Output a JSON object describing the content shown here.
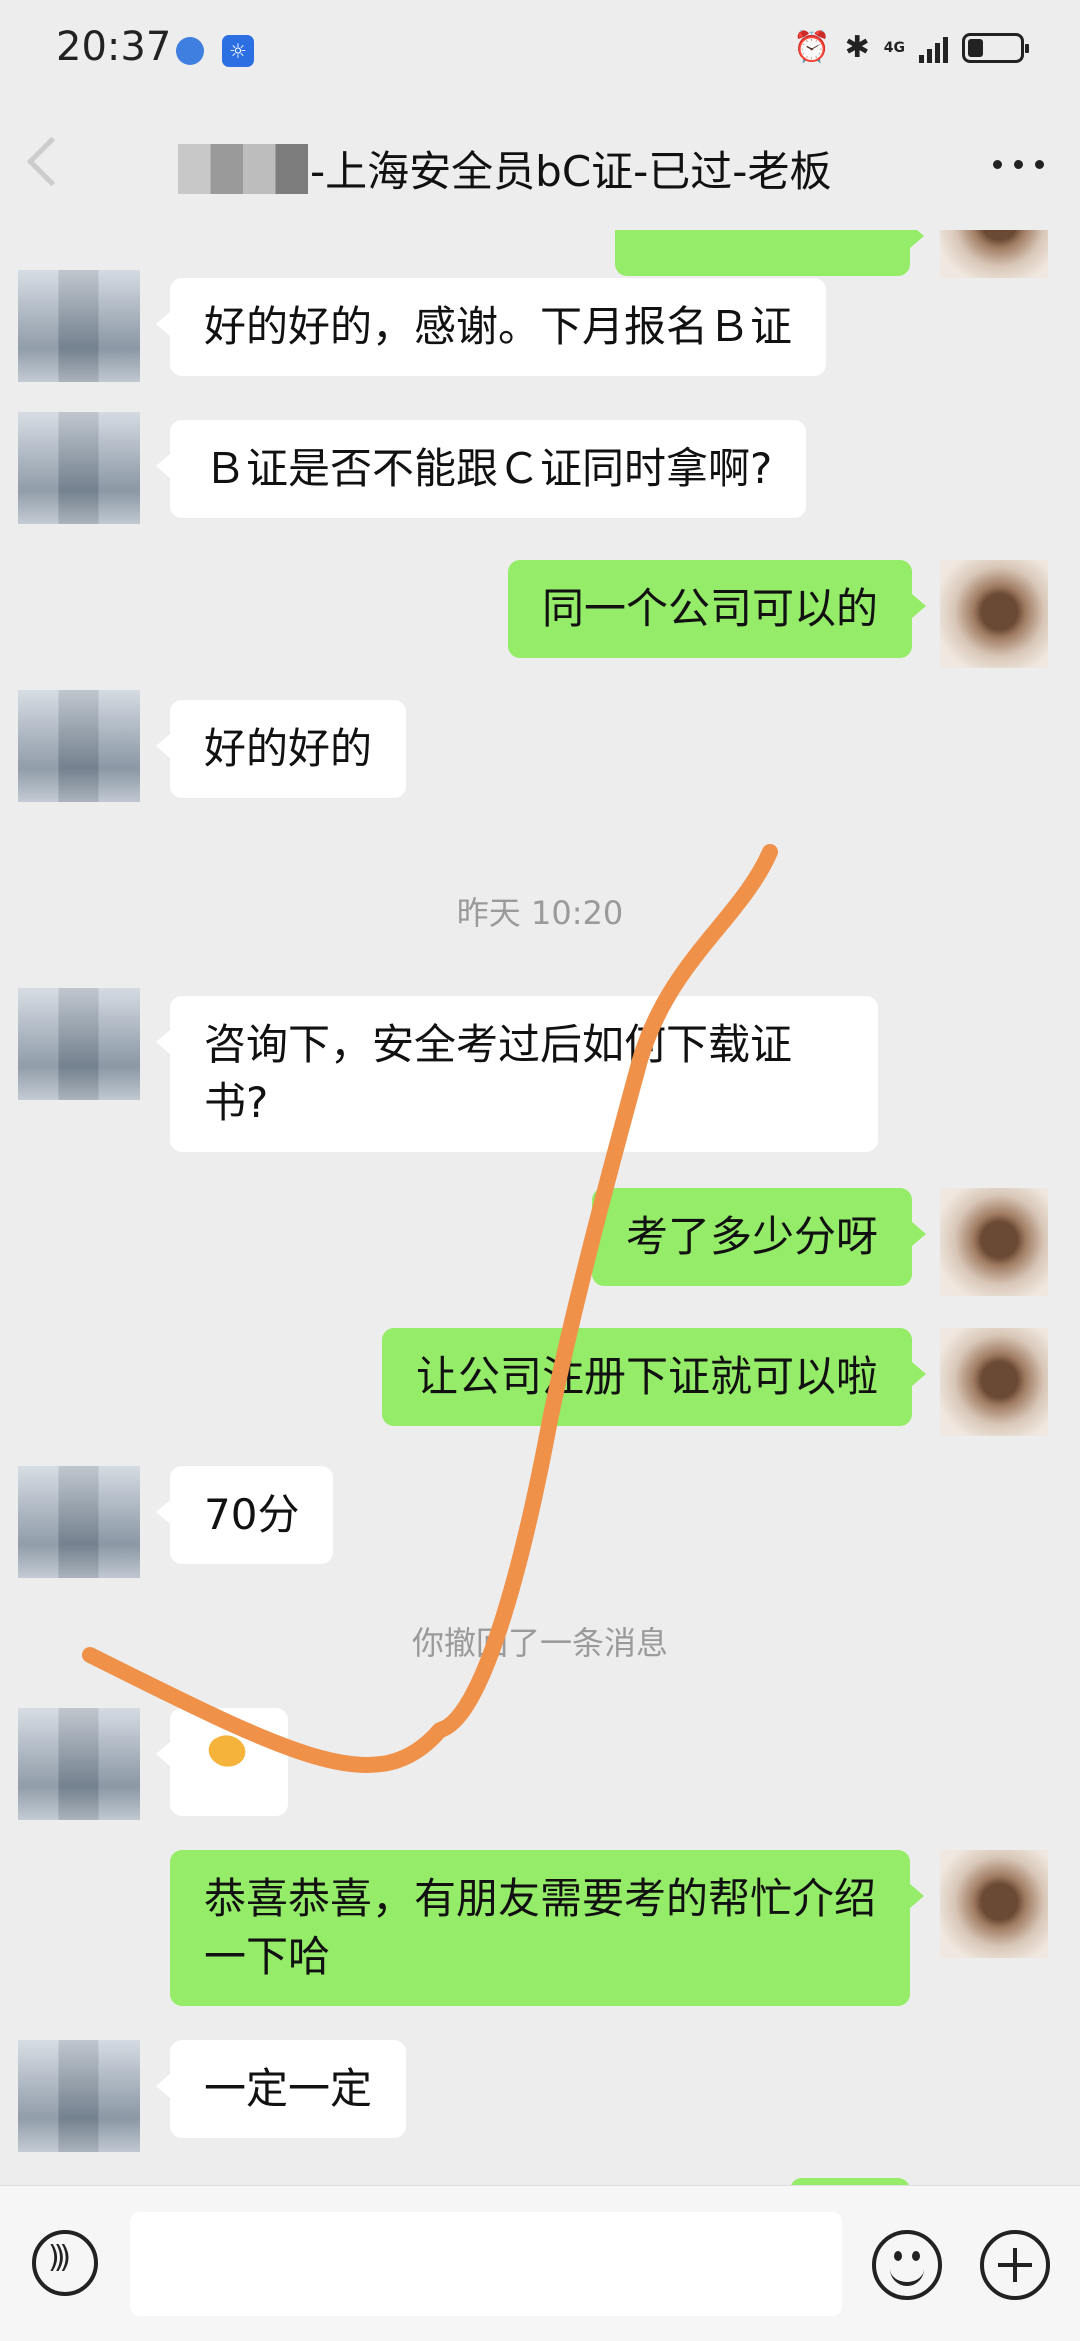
{
  "status_bar": {
    "time": "20:37",
    "network": "4G"
  },
  "header": {
    "title": "-上海安全员bC证-已过-老板"
  },
  "messages": [
    {
      "sender": "other",
      "text": "好的好的，感谢。下月报名Ｂ证"
    },
    {
      "sender": "other",
      "text": "Ｂ证是否不能跟Ｃ证同时拿啊?"
    },
    {
      "sender": "self",
      "text": "同一个公司可以的"
    },
    {
      "sender": "other",
      "text": "好的好的"
    },
    {
      "sender": "other",
      "text": "咨询下，安全考过后如何下载证书?"
    },
    {
      "sender": "self",
      "text": "考了多少分呀"
    },
    {
      "sender": "self",
      "text": "让公司注册下证就可以啦"
    },
    {
      "sender": "other",
      "text": "70分"
    },
    {
      "sender": "other",
      "text": ""
    },
    {
      "sender": "self",
      "text": "恭喜恭喜，有朋友需要考的帮忙介绍一下哈"
    },
    {
      "sender": "other",
      "text": "一定一定"
    }
  ],
  "system": {
    "timestamp": "昨天 10:20",
    "recall_notice": "你撤回了一条消息"
  },
  "icons": {
    "back": "back-arrow-icon",
    "more": "more-icon",
    "voice": "voice-icon",
    "emoji": "emoji-icon",
    "plus": "plus-icon",
    "hand_emoji": "ok-hand-emoji"
  },
  "colors": {
    "self_bubble": "#95ec69",
    "other_bubble": "#ffffff",
    "background": "#ededed",
    "scribble": "#f0914a"
  }
}
